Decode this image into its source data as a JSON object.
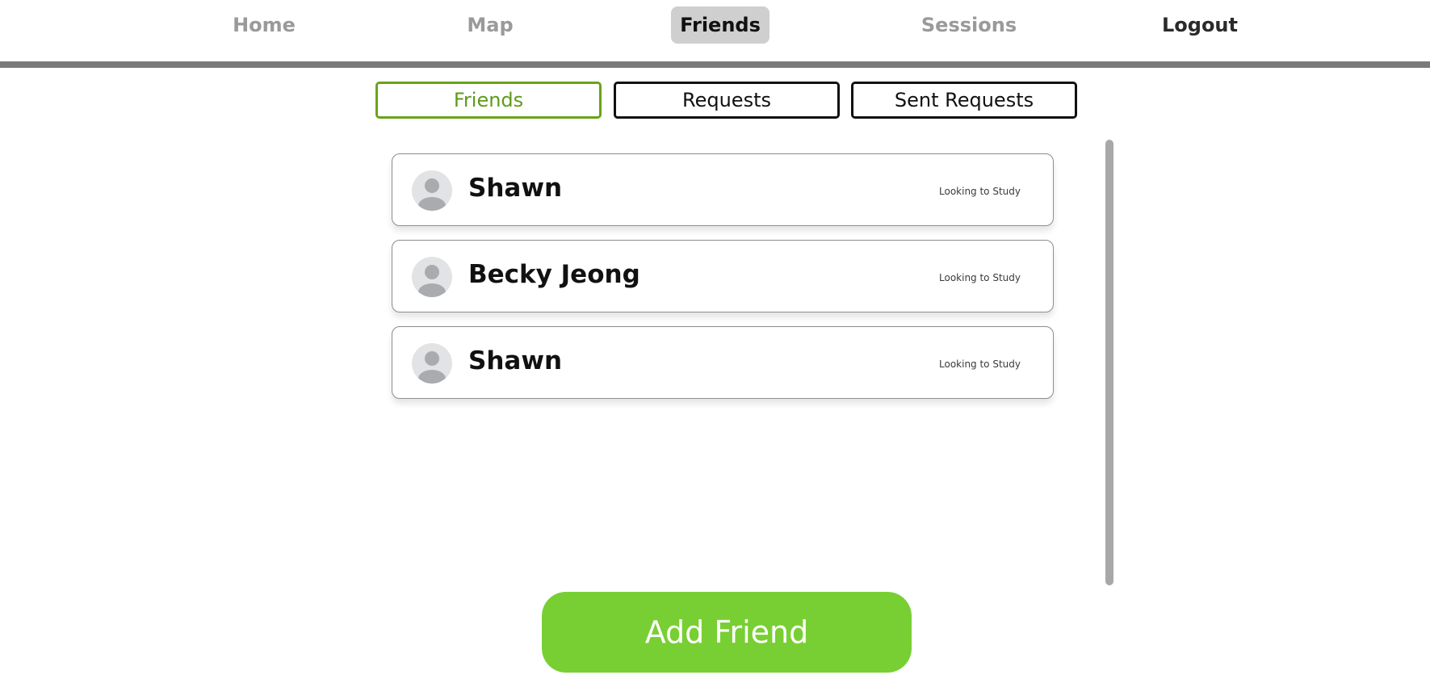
{
  "nav": {
    "home": "Home",
    "map": "Map",
    "friends": "Friends",
    "sessions": "Sessions",
    "logout": "Logout"
  },
  "tabs": {
    "friends": "Friends",
    "requests": "Requests",
    "sent_requests": "Sent Requests"
  },
  "friends": [
    {
      "name": "Shawn",
      "status": "Looking to Study"
    },
    {
      "name": "Becky Jeong",
      "status": "Looking to Study"
    },
    {
      "name": "Shawn",
      "status": "Looking to Study"
    }
  ],
  "add_friend_label": "Add Friend",
  "colors": {
    "accent_green": "#78cf33",
    "active_tab_green": "#6aa31a",
    "nav_active_bg": "#cfcfcf",
    "divider": "#7a7a7a"
  },
  "icons": {
    "avatar": "user-avatar-icon"
  }
}
